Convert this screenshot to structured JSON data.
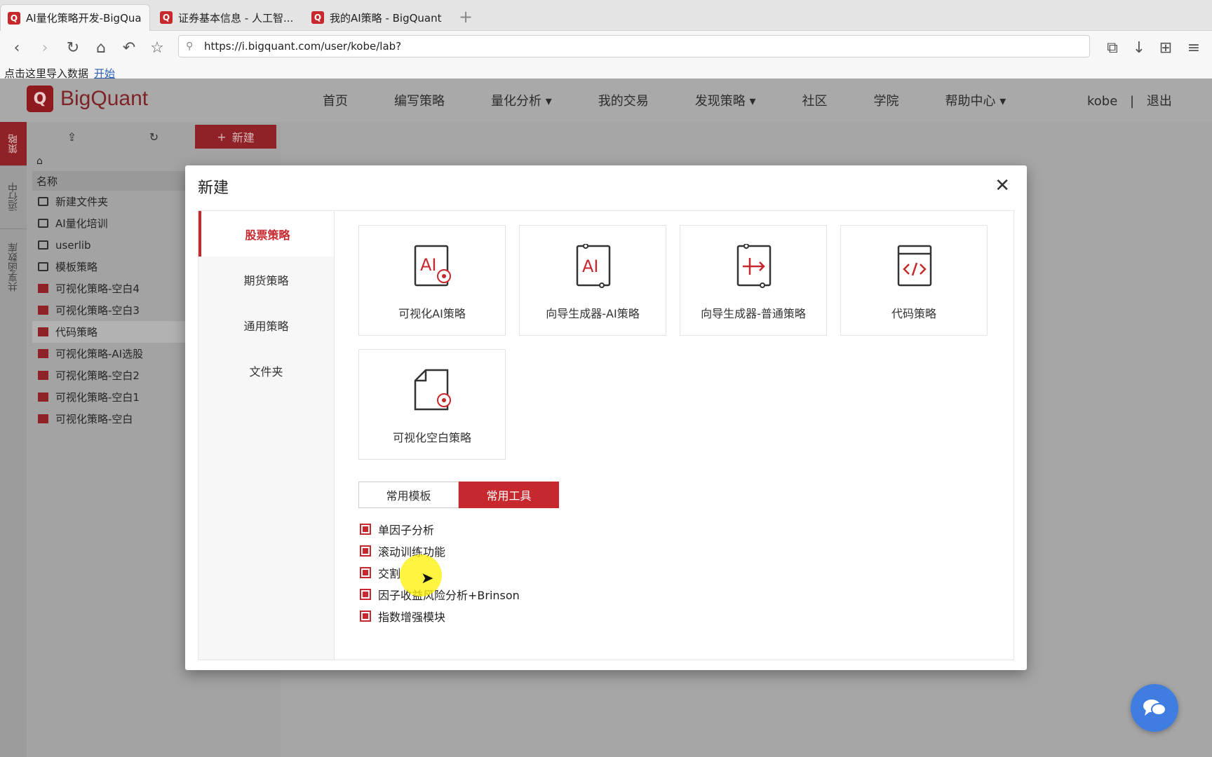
{
  "browser": {
    "tabs": [
      {
        "title": "AI量化策略开发-BigQua...",
        "active": true
      },
      {
        "title": "证券基本信息 - 人工智...",
        "active": false
      },
      {
        "title": "我的AI策略 - BigQuant",
        "active": false
      }
    ],
    "url": "https://i.bigquant.com/user/kobe/lab?",
    "bookmark_text": "点击这里导入数据",
    "bookmark_link": "开始"
  },
  "site": {
    "logo_text": "BigQuant",
    "nav": [
      "首页",
      "编写策略",
      "量化分析 ▾",
      "我的交易",
      "发现策略 ▾",
      "社区",
      "学院",
      "帮助中心 ▾"
    ],
    "user": "kobe",
    "logout": "退出"
  },
  "left_tabs": [
    "策略",
    "运行中",
    "共享函数库"
  ],
  "file_panel": {
    "new_label": "新建",
    "column_header": "名称",
    "items": [
      {
        "name": "新建文件夹",
        "type": "folder"
      },
      {
        "name": "AI量化培训",
        "type": "folder"
      },
      {
        "name": "userlib",
        "type": "folder"
      },
      {
        "name": "模板策略",
        "type": "folder"
      },
      {
        "name": "可视化策略-空白4",
        "type": "strategy"
      },
      {
        "name": "可视化策略-空白3",
        "type": "strategy"
      },
      {
        "name": "代码策略",
        "type": "strategy",
        "selected": true
      },
      {
        "name": "可视化策略-AI选股",
        "type": "strategy"
      },
      {
        "name": "可视化策略-空白2",
        "type": "strategy"
      },
      {
        "name": "可视化策略-空白1",
        "type": "strategy"
      },
      {
        "name": "可视化策略-空白",
        "type": "strategy"
      }
    ]
  },
  "modal": {
    "title": "新建",
    "categories": [
      "股票策略",
      "期货策略",
      "通用策略",
      "文件夹"
    ],
    "active_category": "股票策略",
    "cards": [
      {
        "label": "可视化AI策略",
        "icon": "visual-ai-icon"
      },
      {
        "label": "向导生成器-AI策略",
        "icon": "wizard-ai-icon"
      },
      {
        "label": "向导生成器-普通策略",
        "icon": "wizard-normal-icon"
      },
      {
        "label": "代码策略",
        "icon": "code-icon"
      },
      {
        "label": "可视化空白策略",
        "icon": "visual-blank-icon"
      }
    ],
    "segments": {
      "templates": "常用模板",
      "tools": "常用工具",
      "active": "常用工具"
    },
    "tools": [
      "单因子分析",
      "滚动训练功能",
      "交割",
      "因子收益风险分析+Brinson",
      "指数增强模块"
    ]
  },
  "colors": {
    "brand": "#c7282d",
    "chat": "#3f7ee0"
  }
}
